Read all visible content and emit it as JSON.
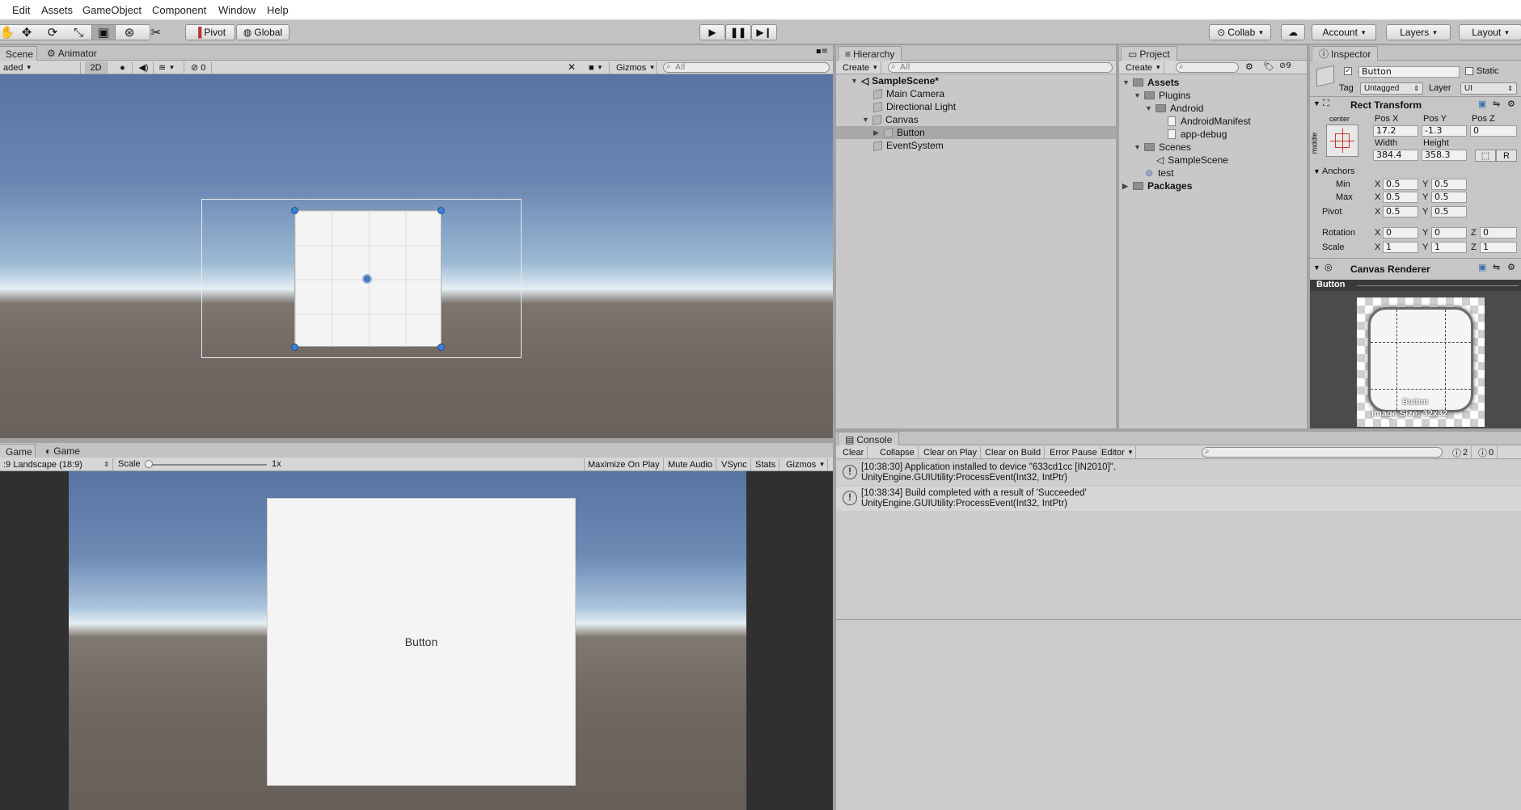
{
  "menu": [
    "Edit",
    "Assets",
    "GameObject",
    "Component",
    "Window",
    "Help"
  ],
  "toolbar": {
    "pivot": "Pivot",
    "global": "Global",
    "collab": "Collab",
    "account": "Account",
    "layers": "Layers",
    "layout": "Layout"
  },
  "scene": {
    "tab_scene": "Scene",
    "tab_animator": "Animator",
    "shading": "aded",
    "btn_2d": "2D",
    "effects_count": "0",
    "gizmos": "Gizmos",
    "search_placeholder": "All"
  },
  "game": {
    "tab_game_left": "Game",
    "tab_game": "Game",
    "aspect": ":9 Landscape (18:9)",
    "scale_label": "Scale",
    "scale_value": "1x",
    "maximize": "Maximize On Play",
    "mute": "Mute Audio",
    "vsync": "VSync",
    "stats": "Stats",
    "gizmos": "Gizmos",
    "button_text": "Button"
  },
  "hierarchy": {
    "tab": "Hierarchy",
    "create": "Create",
    "search_placeholder": "All",
    "scene": "SampleScene*",
    "items": [
      "Main Camera",
      "Directional Light",
      "Canvas",
      "Button",
      "EventSystem"
    ]
  },
  "project": {
    "tab": "Project",
    "create": "Create",
    "hidden_count": "9",
    "assets": "Assets",
    "plugins": "Plugins",
    "android": "Android",
    "manifest": "AndroidManifest",
    "debug": "app-debug",
    "scenes": "Scenes",
    "samplescene": "SampleScene",
    "test": "test",
    "packages": "Packages"
  },
  "inspector": {
    "tab": "Inspector",
    "name": "Button",
    "static": "Static",
    "tag_label": "Tag",
    "tag": "Untagged",
    "layer_label": "Layer",
    "layer": "UI",
    "rect_transform": "Rect Transform",
    "anchor_h": "center",
    "anchor_v": "middle",
    "pos_x_label": "Pos X",
    "pos_y_label": "Pos Y",
    "pos_z_label": "Pos Z",
    "pos_x": "17.2",
    "pos_y": "-1.3",
    "pos_z": "0",
    "width_label": "Width",
    "height_label": "Height",
    "width": "384.4",
    "height": "358.3",
    "r_btn": "R",
    "anchors": "Anchors",
    "min": "Min",
    "max": "Max",
    "pivot": "Pivot",
    "rotation": "Rotation",
    "scale": "Scale",
    "axis_x": "X",
    "axis_y": "Y",
    "axis_z": "Z",
    "min_x": "0.5",
    "min_y": "0.5",
    "max_x": "0.5",
    "max_y": "0.5",
    "pivot_x": "0.5",
    "pivot_y": "0.5",
    "rot_x": "0",
    "rot_y": "0",
    "rot_z": "0",
    "scale_x": "1",
    "scale_y": "1",
    "scale_z": "1",
    "canvas_renderer": "Canvas Renderer",
    "preview_title": "Button",
    "preview_name": "Button",
    "image_size": "Image Size: 32x32"
  },
  "console": {
    "tab": "Console",
    "clear": "Clear",
    "collapse": "Collapse",
    "clear_on_play": "Clear on Play",
    "clear_on_build": "Clear on Build",
    "error_pause": "Error Pause",
    "editor": "Editor",
    "warn_count": "2",
    "error_count": "0",
    "logs": [
      {
        "line1": "[10:38:30] Application installed to device \"633cd1cc [IN2010]\".",
        "line2": "UnityEngine.GUIUtility:ProcessEvent(Int32, IntPtr)"
      },
      {
        "line1": "[10:38:34] Build completed with a result of 'Succeeded'",
        "line2": "UnityEngine.GUIUtility:ProcessEvent(Int32, IntPtr)"
      }
    ]
  }
}
